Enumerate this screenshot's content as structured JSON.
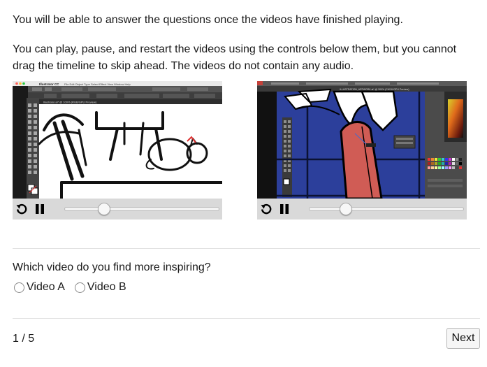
{
  "instructions": {
    "line1": "You will be able to answer the questions once the videos have finished playing.",
    "line2": "You can play, pause, and restart the videos using the controls below them, but you cannot drag the timeline to skip ahead. The videos do not contain any audio."
  },
  "videos": [
    {
      "id": "A",
      "app_title": "Illustrator CC",
      "doc_tab": "Illustrator.ai* @ 100% (RGB/GPU Preview)",
      "progress": 0.25,
      "state": "playing"
    },
    {
      "id": "B",
      "app_title": "Illustrator CC",
      "doc_tab": "ILLUSTRATION_ARTWORK.ai* @ 300% (CMYK/GPU Preview)",
      "progress": 0.23,
      "state": "playing"
    }
  ],
  "question": {
    "text": "Which video do you find more inspiring?",
    "options": [
      "Video A",
      "Video B"
    ]
  },
  "footer": {
    "progress": "1 / 5",
    "next_label": "Next"
  },
  "icons": {
    "restart": "restart-icon",
    "pause": "pause-icon"
  },
  "colors": {
    "control_bar": "#d9d9d9",
    "video_b_background": "#2c3f9b",
    "trunk": "#d05c55"
  }
}
